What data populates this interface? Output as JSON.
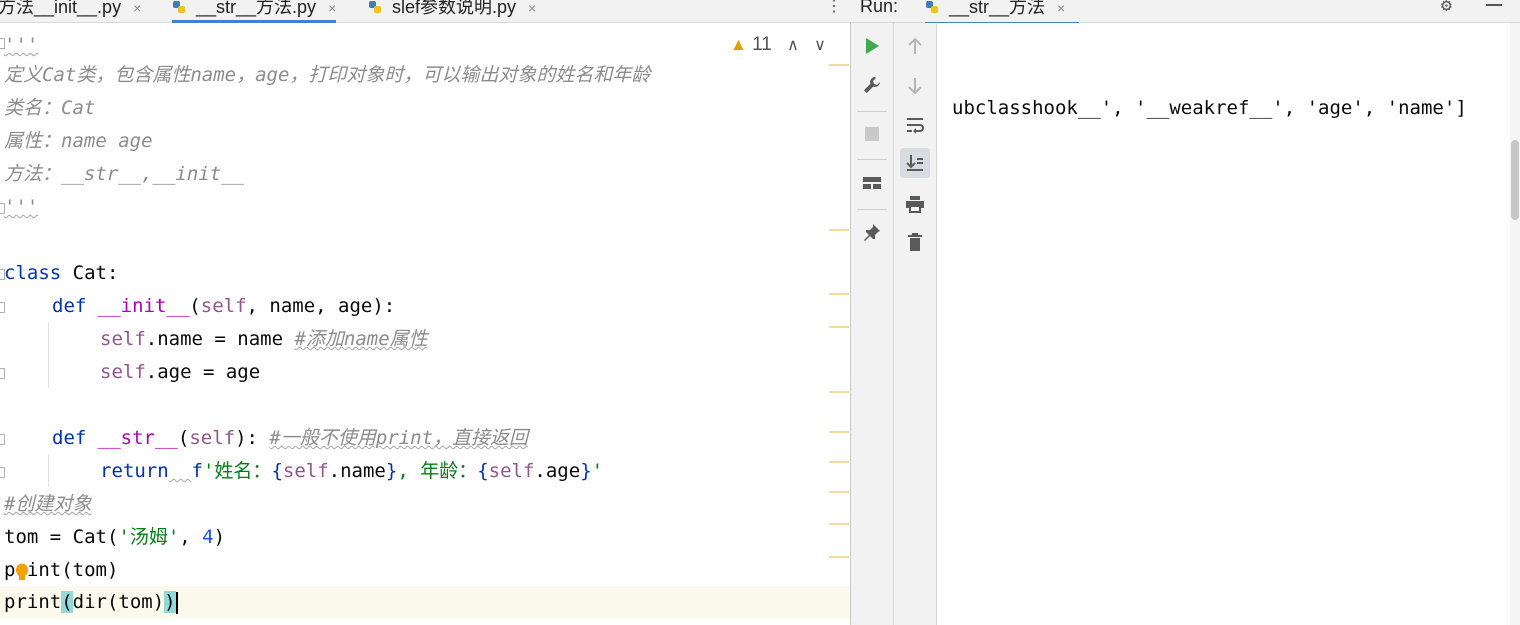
{
  "editor": {
    "tabs": [
      {
        "label": "方法__init__.py",
        "active": false
      },
      {
        "label": "__str__方法.py",
        "active": true
      },
      {
        "label": "slef参数说明.py",
        "active": false
      }
    ],
    "close_glyph": "×",
    "more_glyph": "⋮",
    "inspection": {
      "warning_glyph": "▲",
      "count": "11",
      "prev_glyph": "∧",
      "next_glyph": "∨"
    },
    "code": {
      "l1": "'''",
      "l2": "定义Cat类，包含属性name，age，打印对象时，可以输出对象的姓名和年龄",
      "l3": "类名：Cat",
      "l4": "属性：name age",
      "l5": "方法：__str__,__init__",
      "l6": "'''",
      "l8_kw": "class",
      "l8_rest": " Cat:",
      "l9_def": "def",
      "l9_name": "__init__",
      "l9_open": "(",
      "l9_self": "self",
      "l9_rest": ", name, age):",
      "l10_self": "self",
      "l10_rest": ".name = name ",
      "l10_comment": "#添加name属性",
      "l11_self": "self",
      "l11_rest": ".age = age",
      "l13_def": "def",
      "l13_name": "__str__",
      "l13_open": "(",
      "l13_self": "self",
      "l13_rest": "): ",
      "l13_comment": "#一般不使用print，直接返回",
      "l14_kw": "return",
      "l14_gap": "  ",
      "l14_f": "f",
      "l14_s1": "'姓名：",
      "l14_b1": "{",
      "l14_e1_self": "self",
      "l14_e1_rest": ".name",
      "l14_b2": "}",
      "l14_s2": ", 年龄：",
      "l14_b3": "{",
      "l14_e2_self": "self",
      "l14_e2_rest": ".age",
      "l14_b4": "}",
      "l14_s3": "'",
      "l15": "#创建对象",
      "l16_a": "tom = Cat(",
      "l16_str": "'汤姆'",
      "l16_sep": ", ",
      "l16_num": "4",
      "l16_close": ")",
      "l17": "print(tom)",
      "l18_a": "print",
      "l18_open": "(",
      "l18_mid": "dir(tom)",
      "l18_close": ")"
    }
  },
  "run": {
    "label": "Run:",
    "tab": "__str__方法",
    "close_glyph": "×",
    "gear_glyph": "⚙",
    "console_output": "ubclasshook__', '__weakref__', 'age', 'name']"
  },
  "colors": {
    "keyword": "#0033b3",
    "self": "#94558d",
    "dunder": "#b200b2",
    "string": "#067d17",
    "number": "#1750eb",
    "comment": "#8c8c8c",
    "tab_underline": "#4083c9",
    "run_green": "#3daa4f"
  },
  "icons": {
    "left_toolbar": [
      "run-icon",
      "wrench-icon",
      "stop-icon",
      "layout-icon",
      "pin-icon"
    ],
    "right_toolbar": [
      "arrow-up-icon",
      "arrow-down-icon",
      "soft-wrap-icon",
      "scroll-to-end-icon",
      "print-icon",
      "trash-icon"
    ]
  }
}
